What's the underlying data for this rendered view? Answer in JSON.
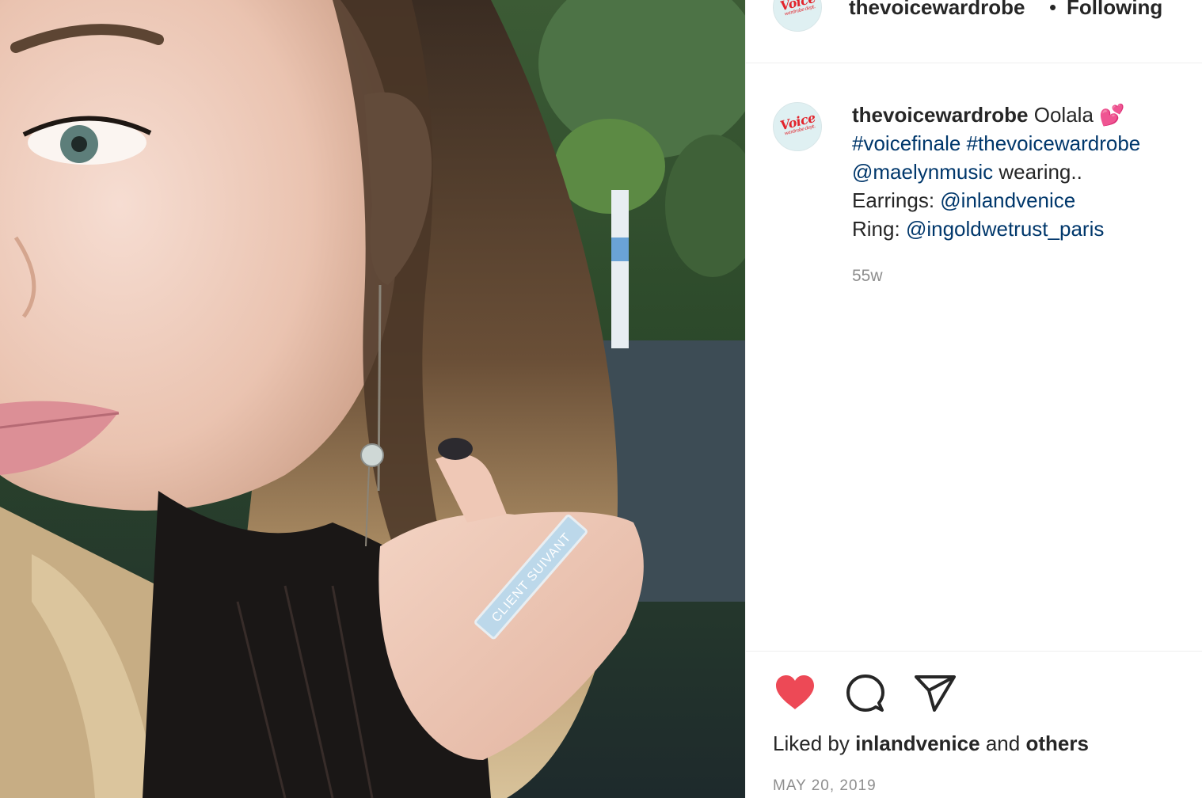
{
  "photo": {
    "ring_engraving": "CLIENT SUIVANT"
  },
  "header": {
    "username": "thevoicewardrobe",
    "separator": "•",
    "follow_status": "Following",
    "avatar_logo": "Voice",
    "avatar_logo_sub": "wardrobe dept."
  },
  "caption": {
    "username": "thevoicewardrobe",
    "text1": "Oolala",
    "emoji": "💕",
    "hashtag1": "#voicefinale",
    "hashtag2": "#thevoicewardrobe",
    "mention1": "@maelynmusic",
    "text2": "wearing..",
    "earrings_label": "Earrings:",
    "earrings_mention": "@inlandvenice",
    "ring_label": "Ring:",
    "ring_mention": "@ingoldwetrust_paris",
    "age": "55w"
  },
  "actions": {
    "like_icon": "heart-filled-icon",
    "comment_icon": "comment-bubble-icon",
    "share_icon": "paper-plane-icon",
    "like_color": "#ed4956"
  },
  "likes": {
    "prefix": "Liked by",
    "user": "inlandvenice",
    "and": "and",
    "others": "others"
  },
  "date": "MAY 20, 2019",
  "colors": {
    "text": "#262626",
    "link": "#00376b",
    "muted": "#8e8e8e",
    "border": "#efefef"
  }
}
